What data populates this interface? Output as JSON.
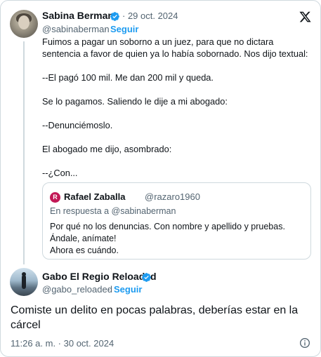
{
  "tweet": {
    "author_name": "Sabina Berman",
    "author_handle": "@sabinaberman",
    "follow_label": "Seguir",
    "date": "· 29 oct. 2024",
    "paragraphs": [
      "Fuimos a pagar un soborno a un juez, para que no dictara sentencia a favor de quien ya lo había sobornado. Nos dijo textual:",
      "--El pagó 100 mil. Me dan 200 mil y queda.",
      "Se lo pagamos. Saliendo le dije a mi abogado:",
      "--Denunciémoslo.",
      "El abogado me dijo, asombrado:",
      "--¿Con..."
    ]
  },
  "quoted_tweet": {
    "avatar_letter": "R",
    "author_name": "Rafael Zaballa",
    "author_handle": "@razaro1960",
    "reply_to": "En respuesta a @sabinaberman",
    "lines": [
      "Por qué no los denuncias. Con nombre y apellido y pruebas.",
      "Ándale, anímate!",
      "Ahora es cuándo."
    ]
  },
  "reply": {
    "author_name": "Gabo El Regio Reloaded",
    "author_handle": "@gabo_reloaded",
    "follow_label": "Seguir",
    "text": "Comiste un delito en pocas palabras, deberías estar en la cárcel",
    "timestamp": "11:26 a. m. · 30 oct. 2024"
  },
  "colors": {
    "accent": "#1d9bf0",
    "text": "#0f1419",
    "secondary": "#536471",
    "border": "#cfd9de"
  },
  "icons": {
    "verified": "verified-badge-icon",
    "platform": "x-logo-icon",
    "info": "info-icon"
  }
}
